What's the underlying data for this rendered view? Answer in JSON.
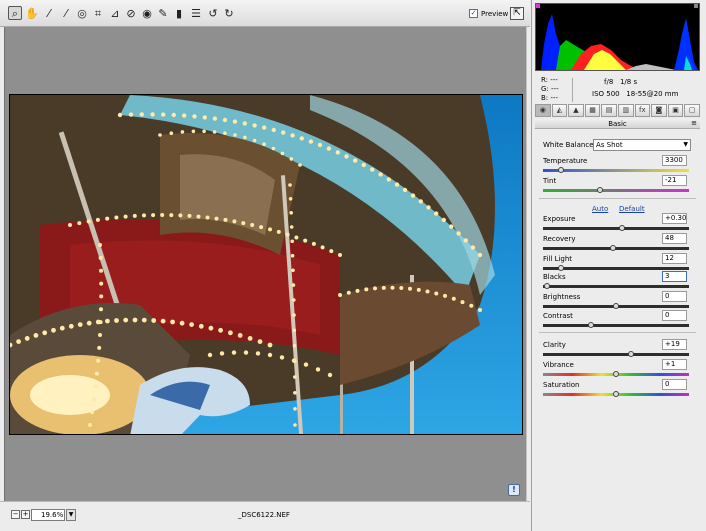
{
  "toolbar": {
    "tools": [
      {
        "name": "zoom-tool",
        "glyph": "⌕",
        "selected": true
      },
      {
        "name": "hand-tool",
        "glyph": "✋"
      },
      {
        "name": "white-balance-tool",
        "glyph": "⁄"
      },
      {
        "name": "color-sampler-tool",
        "glyph": "⁄"
      },
      {
        "name": "target-adjustment-tool",
        "glyph": "◎"
      },
      {
        "name": "crop-tool",
        "glyph": "⌗"
      },
      {
        "name": "straighten-tool",
        "glyph": "⊿"
      },
      {
        "name": "spot-removal-tool",
        "glyph": "⊘"
      },
      {
        "name": "red-eye-tool",
        "glyph": "◉"
      },
      {
        "name": "adjustment-brush-tool",
        "glyph": "✎"
      },
      {
        "name": "graduated-filter-tool",
        "glyph": "▮"
      },
      {
        "name": "preferences-tool",
        "glyph": "☰"
      },
      {
        "name": "rotate-left-tool",
        "glyph": "↺"
      },
      {
        "name": "rotate-right-tool",
        "glyph": "↻"
      }
    ],
    "preview_label": "Preview",
    "preview_checked": "✓",
    "fullscreen_glyph": "⇱"
  },
  "status": {
    "zoom_out": "−",
    "zoom_in": "+",
    "zoom_value": "19.6%",
    "zoom_arrow": "▼",
    "filename": "_DSC6122.NEF",
    "help_glyph": "!"
  },
  "info": {
    "r_label": "R:",
    "r_value": "---",
    "g_label": "G:",
    "g_value": "---",
    "b_label": "B:",
    "b_value": "---",
    "aperture": "f/8",
    "shutter": "1/8 s",
    "iso": "ISO 500",
    "lens": "18-55@20 mm"
  },
  "tabs": [
    "◉",
    "◭",
    "▲",
    "▦",
    "▤",
    "▥",
    "fx",
    "◙",
    "▣",
    "▢"
  ],
  "panel": {
    "title": "Basic",
    "menu_glyph": "≡"
  },
  "basic": {
    "white_balance_label": "White Balance:",
    "white_balance_value": "As Shot",
    "temperature": {
      "label": "Temperature",
      "value": "3300",
      "level": 0.12
    },
    "tint": {
      "label": "Tint",
      "value": "-21",
      "level": 0.39
    },
    "auto_label": "Auto",
    "default_label": "Default",
    "exposure": {
      "label": "Exposure",
      "value": "+0.30",
      "level": 0.54
    },
    "recovery": {
      "label": "Recovery",
      "value": "48",
      "level": 0.48
    },
    "fill_light": {
      "label": "Fill Light",
      "value": "12",
      "level": 0.12
    },
    "blacks": {
      "label": "Blacks",
      "value": "3",
      "level": 0.03
    },
    "brightness": {
      "label": "Brightness",
      "value": "0",
      "level": 0.5
    },
    "contrast": {
      "label": "Contrast",
      "value": "0",
      "level": 0.33
    },
    "clarity": {
      "label": "Clarity",
      "value": "+19",
      "level": 0.6
    },
    "vibrance": {
      "label": "Vibrance",
      "value": "+1",
      "level": 0.5
    },
    "saturation": {
      "label": "Saturation",
      "value": "0",
      "level": 0.5
    }
  },
  "colors": {
    "sky": "#1e8fd0",
    "canopy_dark": "#3a2a18",
    "red_curtain": "#8a1a1a",
    "light_bulb": "#ffe6a0",
    "teal": "#6fb9c8"
  }
}
